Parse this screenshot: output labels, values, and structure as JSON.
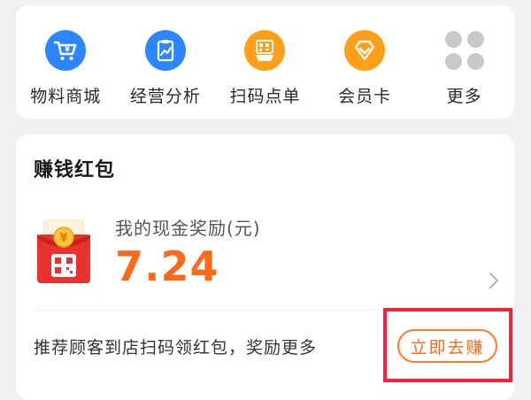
{
  "shortcuts": [
    {
      "label": "物料商城",
      "icon": "shopping-cart-icon",
      "color": "#2d86ff"
    },
    {
      "label": "经营分析",
      "icon": "analytics-chart-icon",
      "color": "#2d86ff"
    },
    {
      "label": "扫码点单",
      "icon": "qr-order-icon",
      "color": "#ff9f1a"
    },
    {
      "label": "会员卡",
      "icon": "diamond-icon",
      "color": "#ff9f1a"
    },
    {
      "label": "更多",
      "icon": "more-apps-icon",
      "color": "#c8c8c8"
    }
  ],
  "earn": {
    "title": "赚钱红包",
    "reward_label": "我的现金奖励(元)",
    "reward_amount": "7.24",
    "invite_text": "推荐顾客到店扫码领红包，奖励更多",
    "button_label": "立即去赚"
  },
  "colors": {
    "accent": "#ff6a1a",
    "highlight": "#ff1f3a",
    "blue": "#2d86ff",
    "orange": "#ff9f1a"
  }
}
